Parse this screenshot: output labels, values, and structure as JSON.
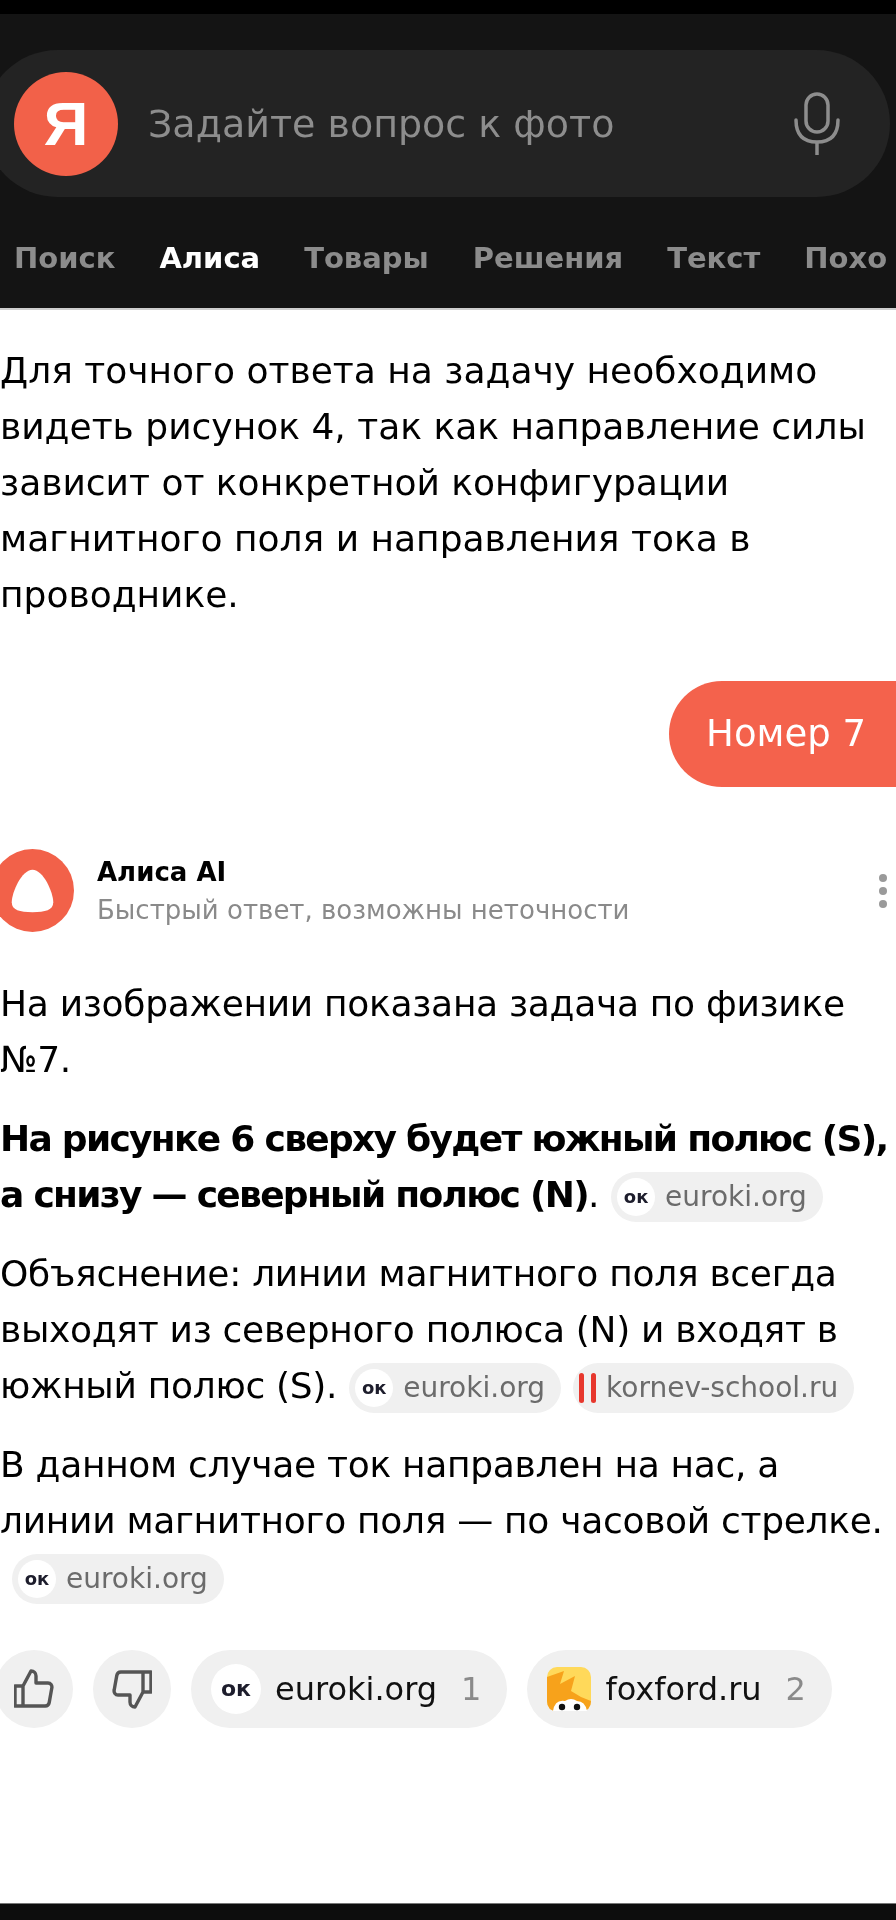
{
  "search": {
    "logo": "Я",
    "placeholder": "Задайте вопрос к фото"
  },
  "tabs": [
    {
      "label": "Поиск",
      "selected": false
    },
    {
      "label": "Алиса",
      "selected": true
    },
    {
      "label": "Товары",
      "selected": false
    },
    {
      "label": "Решения",
      "selected": false
    },
    {
      "label": "Текст",
      "selected": false
    },
    {
      "label": "Похо",
      "selected": false
    }
  ],
  "previous_answer": "Для точного ответа на задачу необходимо видеть рисунок 4, так как направление силы зависит от конкретной конфигурации магнитного поля и направления тока в проводнике.",
  "user_message": "Номер 7",
  "answer": {
    "author": "Алиса AI",
    "note": "Быстрый ответ, возможны неточности",
    "paragraphs": [
      {
        "text": "На изображении показана задача по физике №7."
      },
      {
        "text": "**На рисунке 6 сверху будет южный полюс (S), а снизу — северный полюс (N)**.",
        "sources": [
          {
            "kind": "letters",
            "logo": "ок",
            "label": "euroki.org"
          }
        ]
      },
      {
        "text": "Объяснение: линии магнитного поля всегда выходят из северного полюса (N) и входят в южный полюс (S).",
        "sources": [
          {
            "kind": "letters",
            "logo": "ок",
            "label": "euroki.org"
          },
          {
            "kind": "bars",
            "label": "kornev-school.ru"
          }
        ]
      },
      {
        "text": "В данном случае ток направлен на нас, а линии магнитного поля — по часовой стрелке.",
        "sources": [
          {
            "kind": "letters",
            "logo": "ок",
            "label": "euroki.org"
          }
        ]
      }
    ],
    "source_buttons": [
      {
        "kind": "letters",
        "logo": "ок",
        "label": "euroki.org",
        "count": "1"
      },
      {
        "kind": "fox",
        "label": "foxford.ru",
        "count": "2"
      }
    ]
  }
}
